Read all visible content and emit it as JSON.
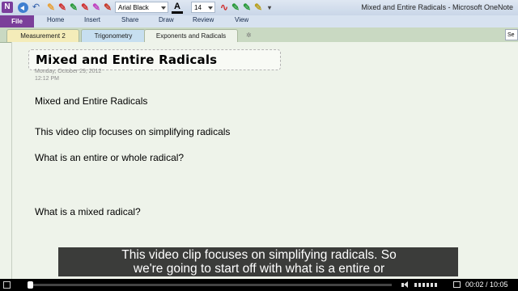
{
  "window": {
    "title": "Mixed and Entire Radicals - Microsoft OneNote",
    "app_icon": "N"
  },
  "toolbar": {
    "font_name": "Arial Black",
    "font_size": "14",
    "font_color_glyph": "A"
  },
  "ribbon": {
    "file": "File",
    "tabs": [
      "Home",
      "Insert",
      "Share",
      "Draw",
      "Review",
      "View"
    ]
  },
  "sections": {
    "tabs": [
      "Measurement 2",
      "Trigonometry",
      "Exponents and Radicals"
    ],
    "active_index": 2,
    "search_text": "Se"
  },
  "page": {
    "title": "Mixed and Entire Radicals",
    "date": "Monday, October 29, 2012",
    "time": "12:12 PM",
    "notes": [
      "Mixed and Entire Radicals",
      "This video clip focuses on simplifying radicals",
      "What is an entire or whole radical?",
      "What is a mixed radical?"
    ]
  },
  "subtitle": {
    "line1": "This video clip focuses on simplifying radicals.  So",
    "line2": "we're going to start off with what is a entire or"
  },
  "player": {
    "current_time": "00:02",
    "total_time": "10:05",
    "time_display": "00:02 / 10:05",
    "progress_fraction": 0.003
  },
  "colors": {
    "file_tab": "#7b3f9a",
    "page_background": "#eef3ea",
    "subtitle_background": "#141414"
  }
}
